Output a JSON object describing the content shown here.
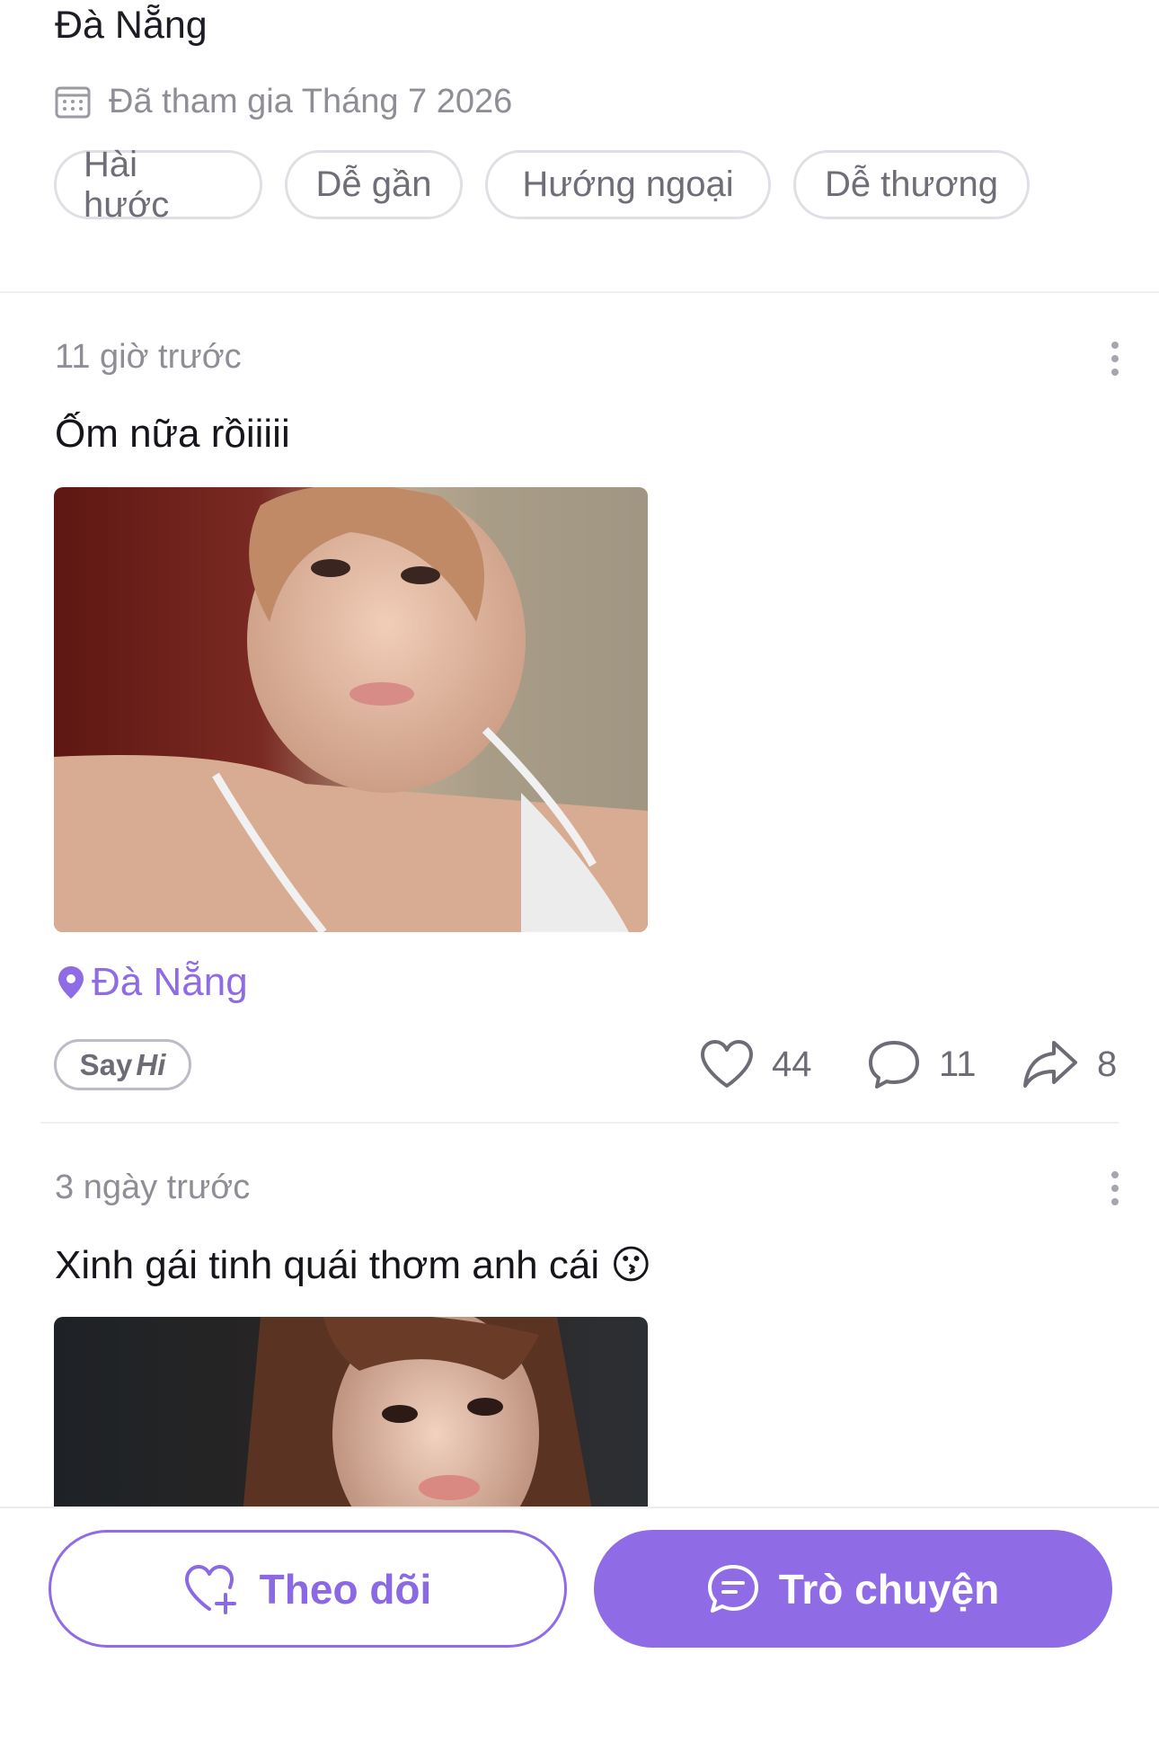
{
  "profile": {
    "city": "Đà Nẵng",
    "joined": "Đã tham gia Tháng 7 2026",
    "tags": [
      "Hài hước",
      "Dễ gần",
      "Hướng ngoại",
      "Dễ thương"
    ]
  },
  "posts": [
    {
      "time": "11 giờ trước",
      "text": "Ốm nữa rồiiiii",
      "location": "Đà Nẵng",
      "say_hi": {
        "say": "Say",
        "hi": "Hi"
      },
      "likes": "44",
      "comments": "11",
      "shares": "8"
    },
    {
      "time": "3 ngày trước",
      "text": "Xinh gái tinh quái thơm anh cái 😗"
    }
  ],
  "actions": {
    "follow": "Theo dõi",
    "chat": "Trò chuyện"
  },
  "colors": {
    "accent": "#8f6ce6",
    "muted_text": "#8e8e96",
    "tag_border": "#e0dfe6"
  },
  "icons": [
    "calendar-icon",
    "more-vertical-icon",
    "location-pin-icon",
    "heart-icon",
    "comment-icon",
    "share-icon",
    "heart-plus-icon",
    "chat-bubble-icon"
  ]
}
